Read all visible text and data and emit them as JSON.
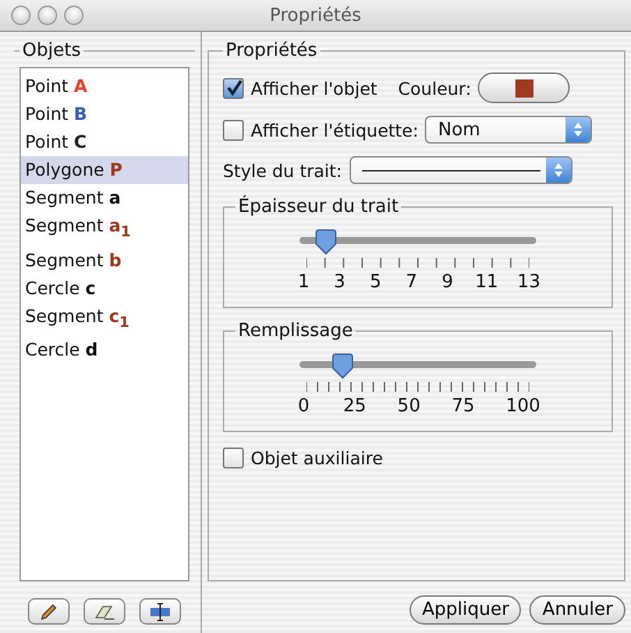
{
  "window": {
    "title": "Propriétés"
  },
  "objects": {
    "title": "Objets",
    "items": [
      {
        "type": "Point",
        "label": "A",
        "color": "#e8402a",
        "selected": false
      },
      {
        "type": "Point",
        "label": "B",
        "color": "#3a5cc0",
        "selected": false
      },
      {
        "type": "Point",
        "label": "C",
        "color": "#222222",
        "selected": false
      },
      {
        "type": "Polygone",
        "label": "P",
        "color": "#a0381e",
        "selected": true
      },
      {
        "type": "Segment",
        "label": "a",
        "color": "#111111",
        "selected": false
      },
      {
        "type": "Segment",
        "label": "a$_{1}$",
        "color": "#a0381e",
        "selected": false
      },
      {
        "type": "Segment",
        "label": "b",
        "color": "#a0381e",
        "selected": false
      },
      {
        "type": "Cercle",
        "label": "c",
        "color": "#111111",
        "selected": false
      },
      {
        "type": "Segment",
        "label": "c$_{1}$",
        "color": "#a0381e",
        "selected": false
      },
      {
        "type": "Cercle",
        "label": "d",
        "color": "#111111",
        "selected": false
      }
    ]
  },
  "properties": {
    "title": "Propriétés",
    "show_object": {
      "label": "Afficher l'objet",
      "checked": true
    },
    "colour": {
      "label": "Couleur:",
      "color": "#a03a22"
    },
    "show_label": {
      "label": "Afficher l'étiquette:",
      "checked": false,
      "value": "Nom"
    },
    "line_style": {
      "label": "Style du trait:",
      "kind": "solid"
    },
    "sliders": [
      {
        "title": "Épaisseur du trait",
        "level": 0.08,
        "ticks": [
          "1",
          "3",
          "5",
          "7",
          "9",
          "11",
          "13"
        ]
      },
      {
        "title": "Remplissage",
        "level": 0.15,
        "ticks": [
          "0",
          "25",
          "50",
          "75",
          "100"
        ]
      }
    ],
    "auxiliary": {
      "label": "Objet auxiliaire",
      "checked": false
    }
  },
  "buttons": [
    "Appliquer",
    "Annuler"
  ]
}
